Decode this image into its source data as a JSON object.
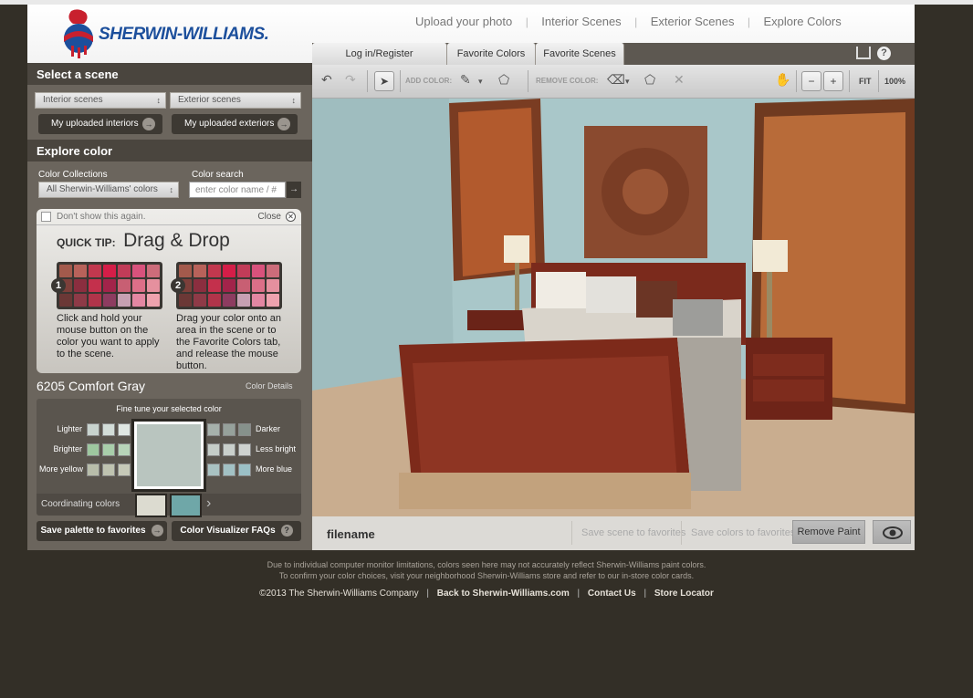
{
  "brand": {
    "name": "SHERWIN-WILLIAMS."
  },
  "topnav": [
    "Upload your photo",
    "Interior Scenes",
    "Exterior Scenes",
    "Explore Colors"
  ],
  "tabs": [
    "Log in/Register",
    "Favorite Colors",
    "Favorite Scenes"
  ],
  "select_scene": {
    "title": "Select a scene",
    "interior": "Interior scenes",
    "exterior": "Exterior scenes",
    "my_interiors": "My uploaded interiors",
    "my_exteriors": "My uploaded exteriors"
  },
  "explore": {
    "title": "Explore color",
    "collections_label": "Color Collections",
    "collections_value": "All Sherwin-Williams' colors",
    "search_label": "Color search",
    "search_placeholder": "enter color name / #",
    "go": "→"
  },
  "tip": {
    "dont_show": "Don't show this again.",
    "close": "Close",
    "quick": "QUICK TIP:",
    "title": "Drag & Drop",
    "step1_num": "1",
    "step2_num": "2",
    "step1": "Click and hold your mouse button on the color you want to apply to the scene.",
    "step2": "Drag your color onto an area in the scene or to the Favorite Colors tab, and release the mouse button."
  },
  "swatch": {
    "name": "6205 Comfort Gray",
    "details": "Color Details",
    "fine_tune": "Fine tune your selected color",
    "lighter": "Lighter",
    "darker": "Darker",
    "brighter": "Brighter",
    "less_bright": "Less bright",
    "more_yellow": "More yellow",
    "more_blue": "More blue",
    "coordinating": "Coordinating colors",
    "main_color": "#b9c5bf"
  },
  "bottom_buttons": {
    "save_palette": "Save palette to favorites",
    "faqs": "Color Visualizer FAQs"
  },
  "toolbar": {
    "add_color": "ADD COLOR:",
    "remove_color": "REMOVE COLOR:",
    "fit": "FIT",
    "zoom": "100%"
  },
  "footerbar": {
    "filename": "filename",
    "save_scene": "Save scene to favorites",
    "save_colors": "Save colors to favorites",
    "remove_paint": "Remove Paint"
  },
  "disclaimer": {
    "line1": "Due to individual computer monitor limitations, colors seen here may not accurately reflect Sherwin-Williams paint colors.",
    "line2": "To confirm your color choices, visit your neighborhood Sherwin-Williams store and refer to our in-store color cards."
  },
  "footer_links": [
    "©2013 The Sherwin-Williams Company",
    "Back to Sherwin-Williams.com",
    "Contact Us",
    "Store Locator"
  ]
}
